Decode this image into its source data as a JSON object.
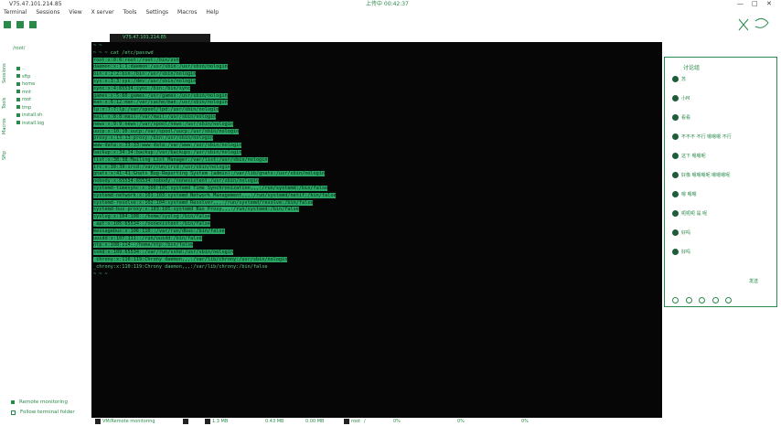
{
  "window": {
    "title": "V75.47.101.214.85",
    "clock": "上传中 00:42:37",
    "min_icon": "minimize-icon",
    "max_icon": "maximize-icon",
    "close_icon": "close-icon"
  },
  "menu": [
    "Terminal",
    "Sessions",
    "View",
    "X server",
    "Tools",
    "Settings",
    "Macros",
    "Help"
  ],
  "sidebar": {
    "vtabs": [
      "Sessions",
      "Tools",
      "Macros",
      "Sftp"
    ],
    "path": "/root/",
    "tree": [
      "..",
      "sftp",
      "home",
      "mnt",
      "root",
      "tmp",
      "install.sh",
      "install.log"
    ],
    "remote_monitoring": "Remote monitoring",
    "follow_folder": "Follow terminal folder"
  },
  "tab": {
    "label": "V75.47.101.214.85"
  },
  "terminal": {
    "prompt_lines": [
      "~ ~",
      "~ ~ ~ cat /etc/passwd"
    ],
    "passwd": [
      "root:x:0:0:root:/root:/bin/zsh",
      "daemon:x:1:1:daemon:/usr/sbin:/usr/sbin/nologin",
      "bin:x:2:2:bin:/bin:/usr/sbin/nologin",
      "sys:x:3:3:sys:/dev:/usr/sbin/nologin",
      "sync:x:4:65534:sync:/bin:/bin/sync",
      "games:x:5:60:games:/usr/games:/usr/sbin/nologin",
      "man:x:6:12:man:/var/cache/man:/usr/sbin/nologin",
      "lp:x:7:7:lp:/var/spool/lpd:/usr/sbin/nologin",
      "mail:x:8:8:mail:/var/mail:/usr/sbin/nologin",
      "news:x:9:9:news:/var/spool/news:/usr/sbin/nologin",
      "uucp:x:10:10:uucp:/var/spool/uucp:/usr/sbin/nologin",
      "proxy:x:13:13:proxy:/bin:/usr/sbin/nologin",
      "www-data:x:33:33:www-data:/var/www:/usr/sbin/nologin",
      "backup:x:34:34:backup:/var/backups:/usr/sbin/nologin",
      "list:x:38:38:Mailing List Manager:/var/list:/usr/sbin/nologin",
      "irc:x:39:39:ircd:/var/run/ircd:/usr/sbin/nologin",
      "gnats:x:41:41:Gnats Bug-Reporting System (admin):/var/lib/gnats:/usr/sbin/nologin",
      "nobody:x:65534:65534:nobody:/nonexistent:/usr/sbin/nologin",
      "systemd-timesync:x:100:101:systemd Time Synchronization,,,:/run/systemd:/bin/false",
      "systemd-network:x:101:103:systemd Network Management,,,:/run/systemd/netif:/bin/false",
      "systemd-resolve:x:102:104:systemd Resolver,,,:/run/systemd/resolve:/bin/false",
      "systemd-bus-proxy:x:103:105:systemd Bus Proxy,,,:/run/systemd:/bin/false",
      "syslog:x:104:108::/home/syslog:/bin/false",
      "_apt:x:105:65534::/nonexistent:/bin/false",
      "messagebus:x:106:110::/var/run/dbus:/bin/false",
      "uuidd:x:107:111::/run/uuidd:/bin/false",
      "ntp:x:108:114::/home/ntp:/bin/false",
      "sshd:x:109:65534::/var/run/sshd:/usr/sbin/nologin",
      "_chrony:x:110:119:Chrony daemon,,,:/var/lib/chrony:/usr/sbin/nologin"
    ],
    "last_line": "_chrony:x:110:119:Chrony daemon,,,:/var/lib/chrony:/bin/false",
    "end_prompt": "~ ~ ~"
  },
  "chat": {
    "header": "讨论组",
    "messages": [
      {
        "name": "苏",
        "text": ""
      },
      {
        "name": "小M",
        "text": ""
      },
      {
        "name": "",
        "text": "看看"
      },
      {
        "name": "",
        "text": "不不不 不行 嗯嗯嗯 不行"
      },
      {
        "name": "",
        "text": "这下 嗯嗯呢"
      },
      {
        "name": "",
        "text": "好像 嗯嗯嗯呢 嗯嗯嗯呢"
      },
      {
        "name": "",
        "text": "嗯 嗯嗯"
      },
      {
        "name": "",
        "text": "呃呃呃 是 呢"
      },
      {
        "name": "",
        "text": "好吗"
      },
      {
        "name": "",
        "text": "好吗"
      }
    ],
    "send_label": "发送"
  },
  "status": [
    "VM/Remote monitoring",
    "1.3 MB",
    "0.43 MB",
    "0.00 MB",
    "root",
    "/",
    "0%",
    "0%",
    "0%"
  ]
}
